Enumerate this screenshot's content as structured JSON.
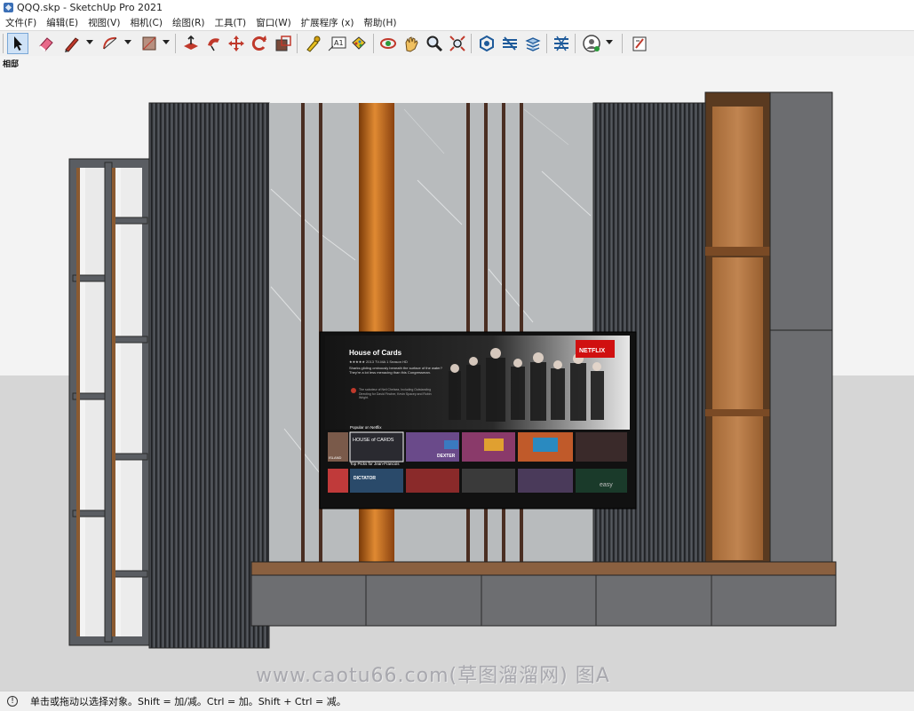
{
  "window": {
    "title": "QQQ.skp - SketchUp Pro 2021"
  },
  "menu": [
    {
      "label": "文件(F)"
    },
    {
      "label": "编辑(E)"
    },
    {
      "label": "视图(V)"
    },
    {
      "label": "相机(C)"
    },
    {
      "label": "绘图(R)"
    },
    {
      "label": "工具(T)"
    },
    {
      "label": "窗口(W)"
    },
    {
      "label": "扩展程序 (x)"
    },
    {
      "label": "帮助(H)"
    }
  ],
  "toolbar": {
    "tools": [
      {
        "icon": "select-arrow-icon",
        "active": true
      },
      {
        "icon": "eraser-icon"
      },
      {
        "icon": "pencil-line-icon"
      },
      {
        "icon": "arc-icon"
      },
      {
        "icon": "rectangle-shape-icon"
      },
      {
        "icon": "push-pull-icon"
      },
      {
        "icon": "follow-me-icon"
      },
      {
        "icon": "move-icon"
      },
      {
        "icon": "rotate-icon"
      },
      {
        "icon": "scale-icon"
      },
      {
        "icon": "tape-measure-icon"
      },
      {
        "icon": "text-icon"
      },
      {
        "icon": "paint-bucket-icon"
      },
      {
        "icon": "orbit-icon"
      },
      {
        "icon": "pan-icon"
      },
      {
        "icon": "zoom-icon"
      },
      {
        "icon": "zoom-extents-icon"
      },
      {
        "icon": "3d-warehouse-icon"
      },
      {
        "icon": "extension-warehouse-icon"
      },
      {
        "icon": "layout-icon"
      },
      {
        "icon": "extension-manager-icon"
      },
      {
        "icon": "account-icon"
      },
      {
        "icon": "send-to-layout-icon"
      }
    ],
    "text_tool_label": "A1"
  },
  "viewport": {
    "scene_label": "相邸",
    "watermark": "www.caotu66.com(草图溜溜网) 图A"
  },
  "tv": {
    "title": "House of Cards",
    "meta": "★★★★★ 2013  TV-MA  1 Season  HD",
    "description": "Sharks gliding ominously beneath the surface of the water? They're a lot less menacing than this Congressman.",
    "awards": "The saboteur of Neil Chelsea, Including Outstanding Directing for David Fincher, Kevin Spacey and Robin Wright.",
    "brand": "NETFLIX",
    "row1_title": "Popular on Netflix",
    "row2_title": "Top Picks for Jean-Francois",
    "row1_tiles": [
      "ISLAND",
      "HOUSE of CARDS",
      "",
      "DEXTER",
      "",
      "",
      "",
      ""
    ],
    "row2_tiles": [
      "",
      "DICTATOR",
      "",
      "",
      "",
      "",
      "",
      "easy"
    ]
  },
  "status": {
    "icon": "info-icon",
    "text": "单击或拖动以选择对象。Shift = 加/减。Ctrl = 加。Shift + Ctrl = 减。"
  },
  "colors": {
    "accent_select": "#cfe2f6",
    "netflix_red": "#e50914",
    "copper": "#c8641a",
    "wood": "#b57a45",
    "slat_dark": "#3c3f44",
    "marble": "#b9bcbe",
    "cabinet_grey": "#6e6f72"
  }
}
